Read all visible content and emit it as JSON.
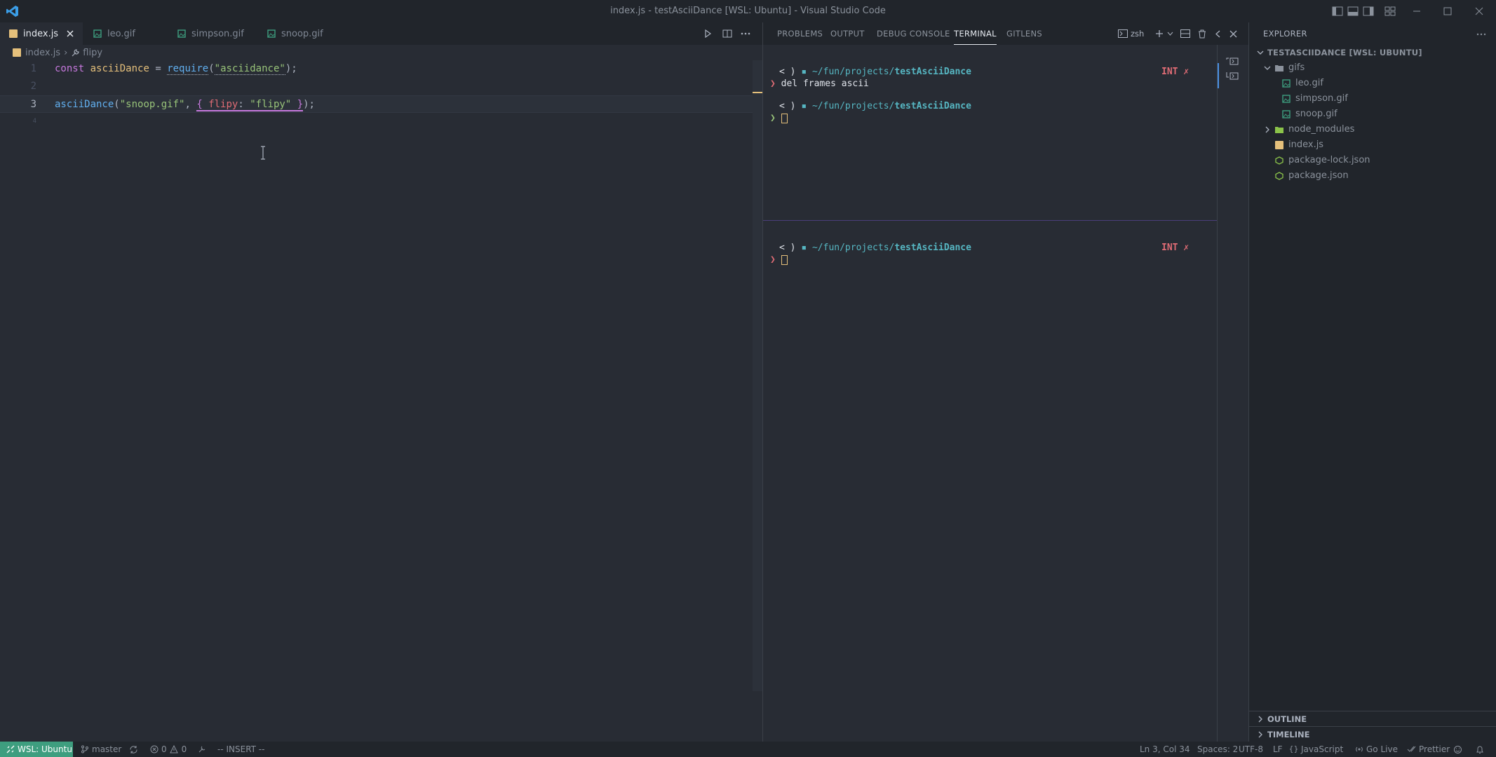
{
  "window": {
    "title": "index.js - testAsciiDance [WSL: Ubuntu] - Visual Studio Code"
  },
  "editor_tabs": [
    {
      "label": "index.js",
      "icon": "js-file-icon",
      "active": true
    },
    {
      "label": "leo.gif",
      "icon": "image-file-icon",
      "active": false
    },
    {
      "label": "simpson.gif",
      "icon": "image-file-icon",
      "active": false
    },
    {
      "label": "snoop.gif",
      "icon": "image-file-icon",
      "active": false
    }
  ],
  "breadcrumb": {
    "file": "index.js",
    "symbol": "flipy"
  },
  "code": {
    "line_numbers": [
      "1",
      "2",
      "3",
      "4"
    ],
    "line1": {
      "kw": "const",
      "var": "asciiDance",
      "eq": "=",
      "fn": "require",
      "open": "(",
      "str": "\"asciidance\"",
      "close": ");"
    },
    "line3": {
      "fn": "asciiDance",
      "open": "(",
      "str1": "\"snoop.gif\"",
      "comma": ",",
      "brace_open": "{",
      "prop": "flipy",
      "colon": ":",
      "str2": "\"flipy\"",
      "brace_close": "}",
      "close": ");"
    }
  },
  "panel": {
    "tabs": [
      "PROBLEMS",
      "OUTPUT",
      "DEBUG CONSOLE",
      "TERMINAL",
      "GITLENS"
    ],
    "active_tab": "TERMINAL",
    "shell": "zsh"
  },
  "terminal": {
    "prompt_head": "< )",
    "path_prefix": "~/fun/projects/",
    "path_dir": "testAsciiDance",
    "int_label": "INT",
    "x_label": "✗",
    "arrow": "❯",
    "command": "del frames ascii"
  },
  "explorer": {
    "title": "EXPLORER",
    "root": "TESTASCIIDANCE [WSL: UBUNTU]",
    "folder": "gifs",
    "gif_files": [
      "leo.gif",
      "simpson.gif",
      "snoop.gif"
    ],
    "node_modules": "node_modules",
    "files": [
      {
        "name": "index.js",
        "icon": "js-file-icon"
      },
      {
        "name": "package-lock.json",
        "icon": "npm-file-icon"
      },
      {
        "name": "package.json",
        "icon": "npm-file-icon"
      }
    ],
    "outline": "OUTLINE",
    "timeline": "TIMELINE"
  },
  "statusbar": {
    "remote": "WSL: Ubuntu",
    "branch": "master",
    "errors": "0",
    "warnings": "0",
    "mode": "-- INSERT --",
    "position": "Ln 3, Col 34",
    "spaces": "Spaces: 2",
    "encoding": "UTF-8",
    "eol": "LF",
    "language": "JavaScript",
    "golive": "Go Live",
    "prettier": "Prettier"
  },
  "colors": {
    "background": "#282c34",
    "sidebar": "#21252b",
    "remote_badge": "#3e9e7f",
    "keyword": "#c678dd",
    "string": "#98c379",
    "function": "#61afef",
    "variable": "#e5c07b"
  }
}
